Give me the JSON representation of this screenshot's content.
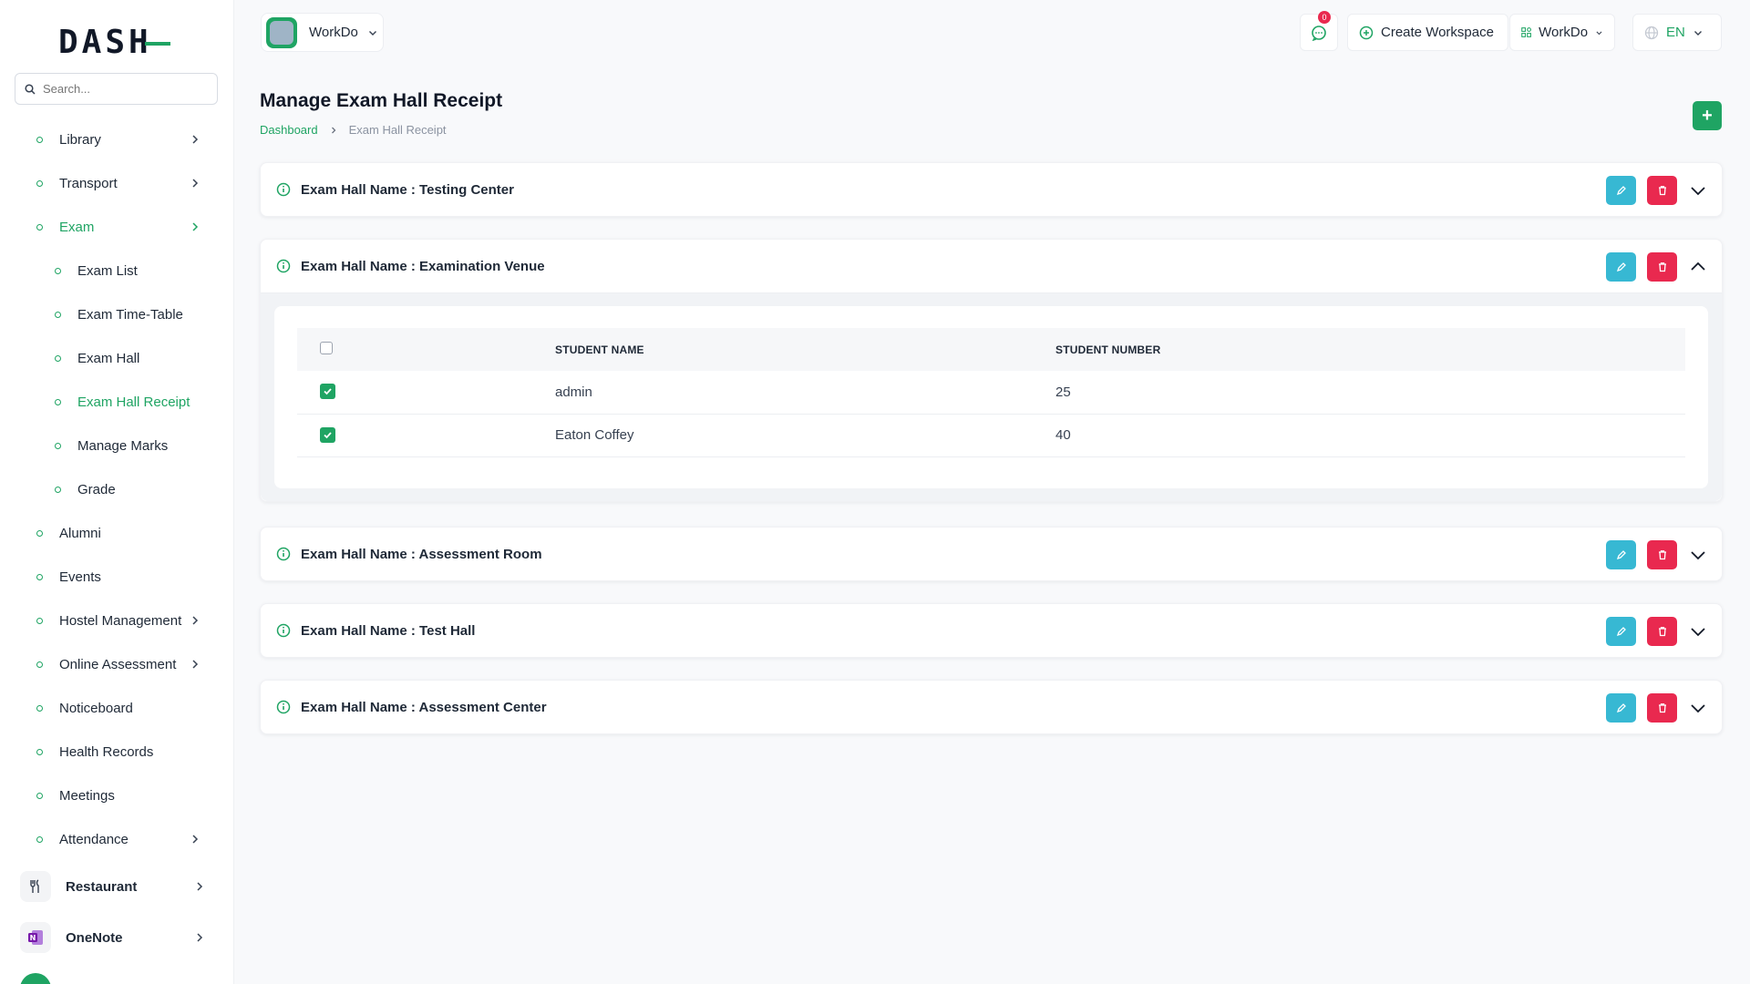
{
  "sidebar": {
    "search_placeholder": "Search...",
    "items": [
      {
        "label": "Library",
        "chevron": true,
        "sub": false
      },
      {
        "label": "Transport",
        "chevron": true,
        "sub": false
      },
      {
        "label": "Exam",
        "chevron": true,
        "sub": false,
        "active": true
      },
      {
        "label": "Exam List",
        "sub": true
      },
      {
        "label": "Exam Time-Table",
        "sub": true
      },
      {
        "label": "Exam Hall",
        "sub": true
      },
      {
        "label": "Exam Hall Receipt",
        "sub": true,
        "active": true
      },
      {
        "label": "Manage Marks",
        "sub": true
      },
      {
        "label": "Grade",
        "sub": true
      },
      {
        "label": "Alumni",
        "sub": false
      },
      {
        "label": "Events",
        "sub": false
      },
      {
        "label": "Hostel Management",
        "chevron": true,
        "sub": false
      },
      {
        "label": "Online Assessment",
        "chevron": true,
        "sub": false
      },
      {
        "label": "Noticeboard",
        "sub": false
      },
      {
        "label": "Health Records",
        "sub": false
      },
      {
        "label": "Meetings",
        "sub": false
      },
      {
        "label": "Attendance",
        "chevron": true,
        "sub": false
      }
    ],
    "apps": [
      {
        "label": "Restaurant",
        "icon": "restaurant-icon"
      },
      {
        "label": "OneNote",
        "icon": "onenote-icon"
      }
    ]
  },
  "header": {
    "workspace_name": "WorkDo",
    "notification_count": "0",
    "create_workspace_label": "Create Workspace",
    "workdo_label": "WorkDo",
    "language": "EN"
  },
  "main": {
    "title": "Manage Exam Hall Receipt",
    "breadcrumb": {
      "home": "Dashboard",
      "current": "Exam Hall Receipt"
    },
    "halls": [
      {
        "title": "Exam Hall Name : Testing Center",
        "expanded": false
      },
      {
        "title": "Exam Hall Name : Examination Venue",
        "expanded": true,
        "table": {
          "headers": [
            "STUDENT NAME",
            "STUDENT NUMBER"
          ],
          "rows": [
            {
              "name": "admin",
              "number": "25",
              "checked": true
            },
            {
              "name": "Eaton Coffey",
              "number": "40",
              "checked": true
            }
          ]
        }
      },
      {
        "title": "Exam Hall Name : Assessment Room",
        "expanded": false
      },
      {
        "title": "Exam Hall Name : Test Hall",
        "expanded": false
      },
      {
        "title": "Exam Hall Name : Assessment Center",
        "expanded": false
      }
    ]
  },
  "colors": {
    "brand": "#1fa463",
    "edit": "#37b8d3",
    "delete": "#e9294f"
  }
}
